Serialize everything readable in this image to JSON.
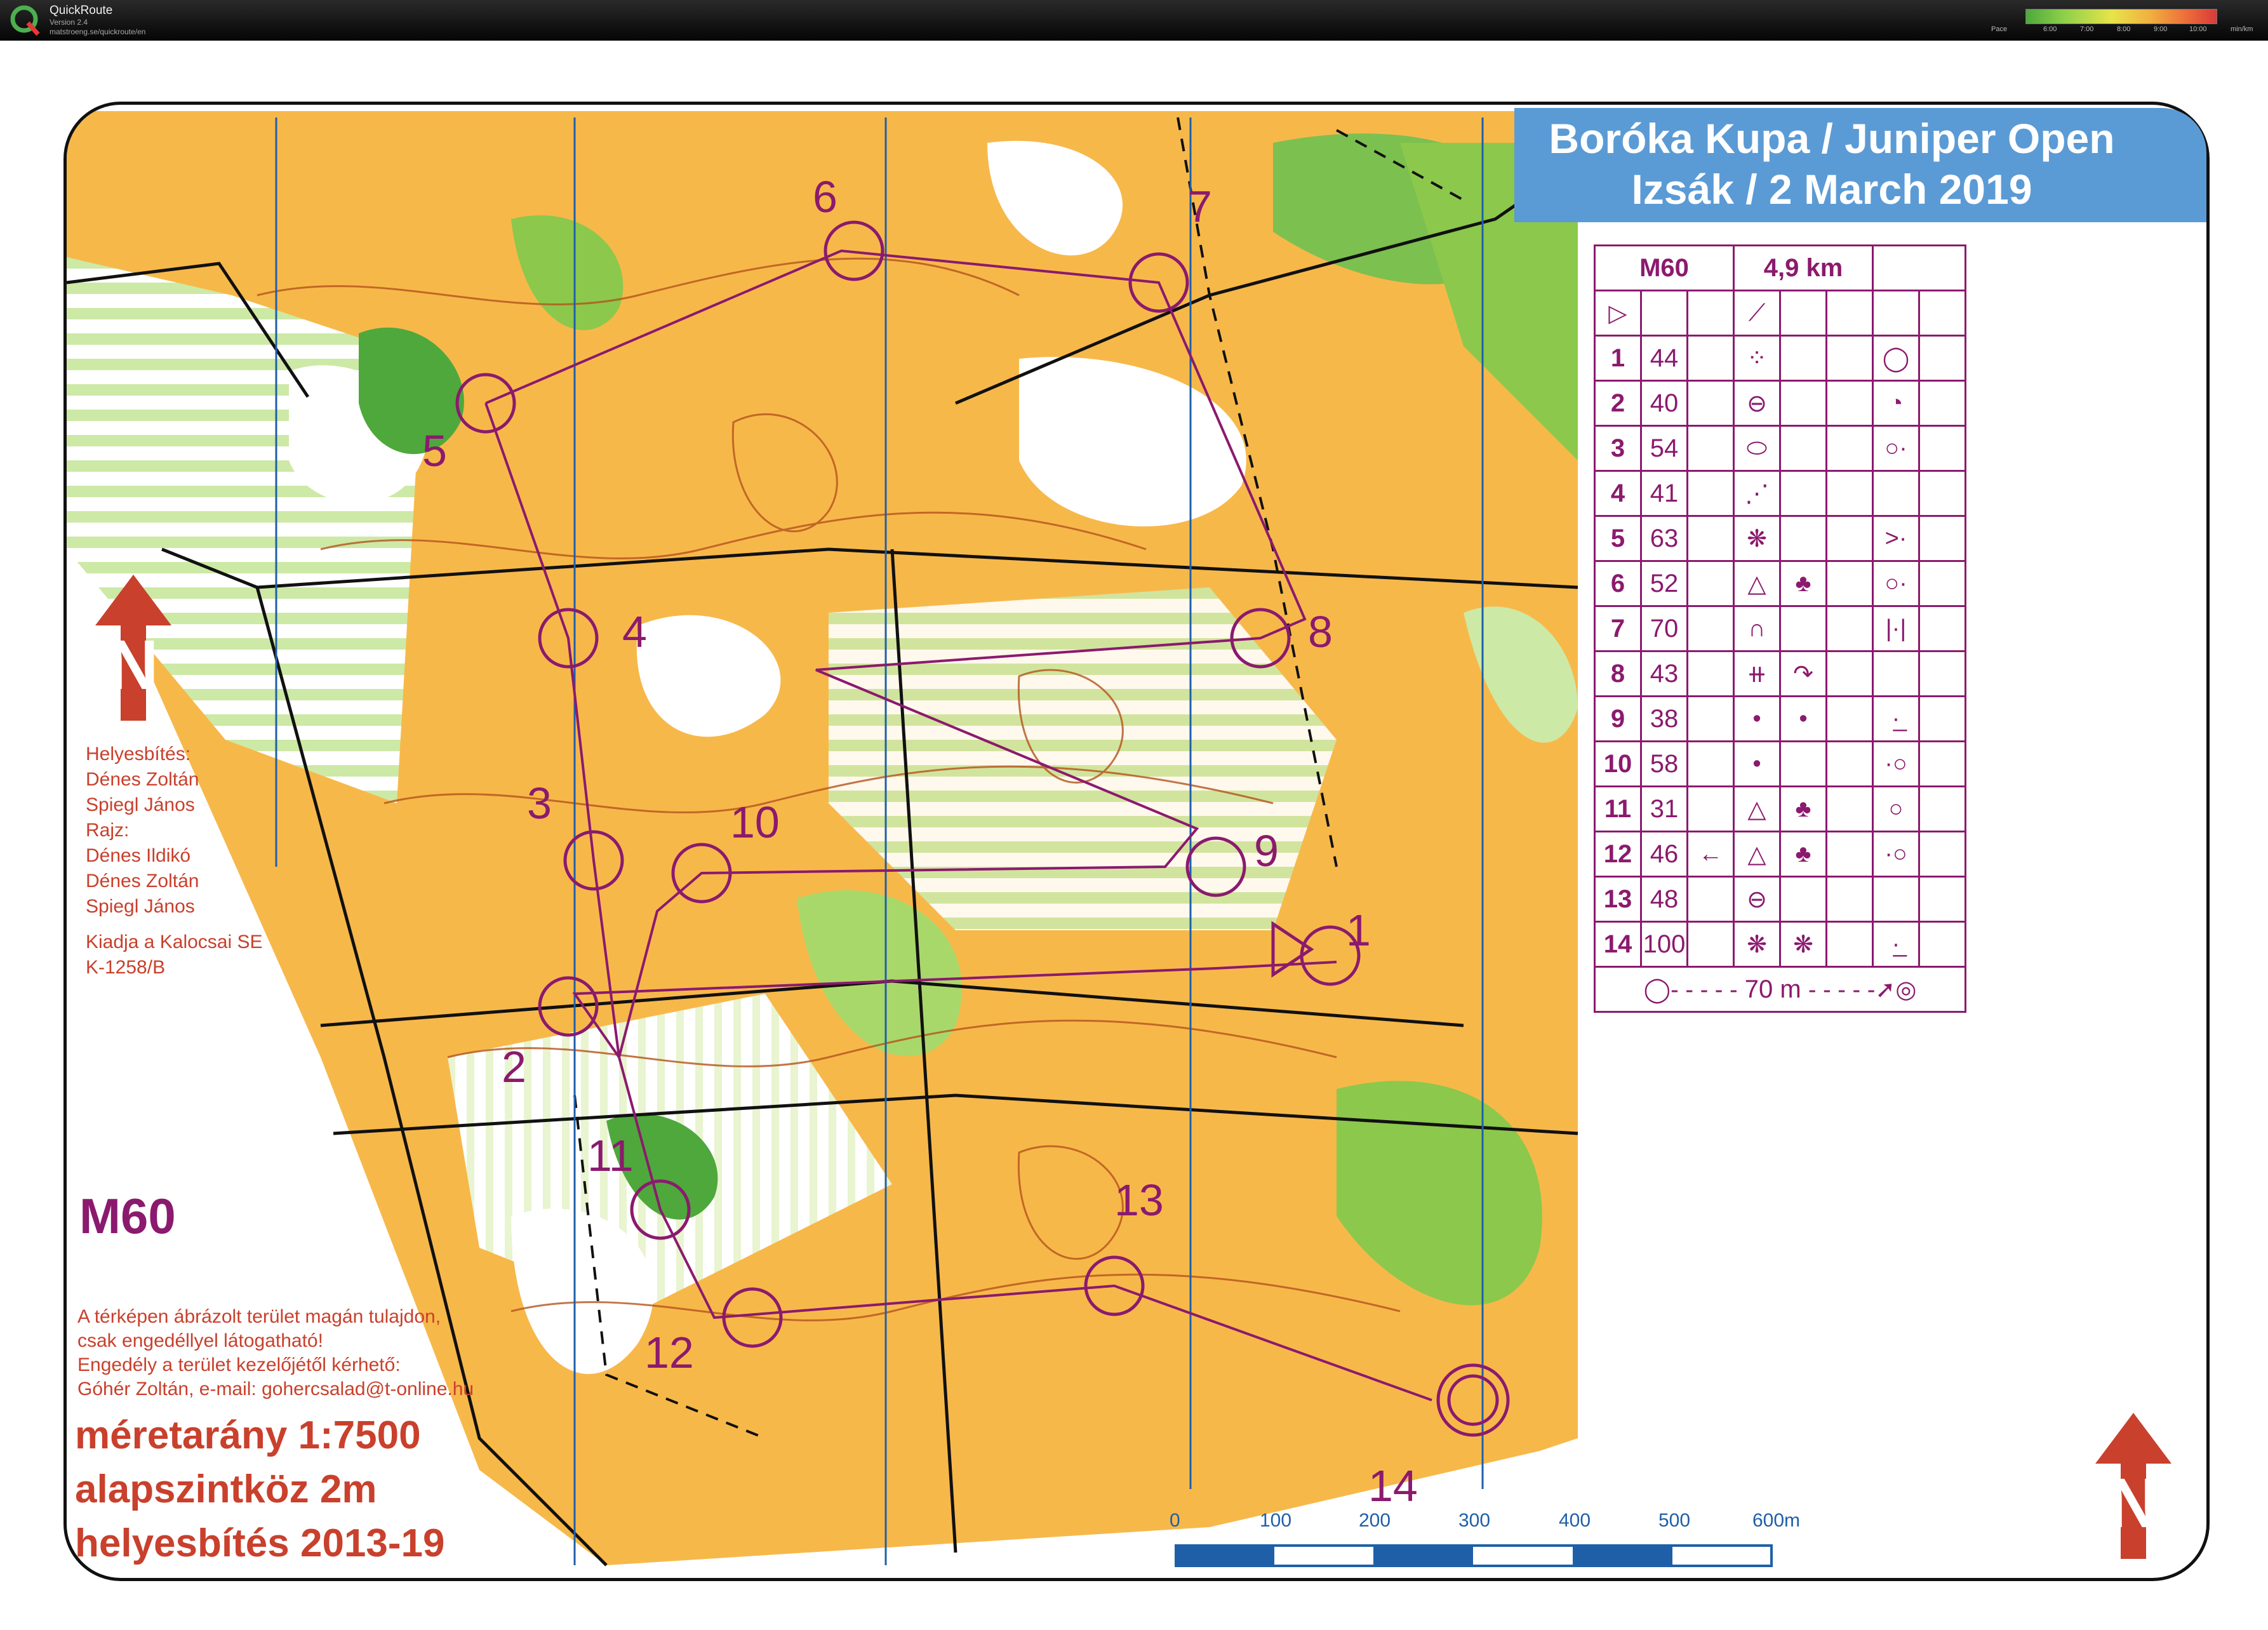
{
  "app": {
    "name": "QuickRoute",
    "version": "Version 2.4",
    "url": "matstroeng.se/quickroute/en",
    "pace_label": "Pace",
    "pace_ticks": [
      "6:00",
      "7:00",
      "8:00",
      "9:00",
      "10:00"
    ],
    "pace_unit": "min/km"
  },
  "map": {
    "title_line1": "Boróka Kupa / Juniper Open",
    "title_line2": "Izsák /  2 March 2019",
    "class_name": "M60",
    "scale": "méretarány 1:7500",
    "contour": "alapszintköz 2m",
    "updated": "helyesbítés 2013-19",
    "credits": [
      "Helyesbítés:",
      "Dénes Zoltán",
      "Spiegl János",
      "Rajz:",
      "Dénes Ildikó",
      "Dénes Zoltán",
      "Spiegl János",
      "",
      "Kiadja a Kalocsai SE",
      "K-1258/B"
    ],
    "notice": [
      "A térképen ábrázolt terület magán tulajdon,",
      "csak engedéllyel látogatható!",
      "Engedély a terület kezelőjétől kérhető:",
      "Góhér Zoltán, e-mail: gohercsalad@t-online.hu"
    ],
    "scale_bar_labels": [
      "0",
      "100",
      "200",
      "300",
      "400",
      "500",
      "600m"
    ],
    "control_labels": [
      "1",
      "2",
      "3",
      "4",
      "5",
      "6",
      "7",
      "8",
      "9",
      "10",
      "11",
      "12",
      "13",
      "14"
    ]
  },
  "colors": {
    "course": "#8b1a6e",
    "forest_open": "#f4a020",
    "green": "#8cc84b",
    "header_blue": "#5b9bd5",
    "red_text": "#c9402c"
  },
  "description": {
    "class": "M60",
    "length": "4,9 km",
    "rows": [
      {
        "num": "1",
        "code": "44"
      },
      {
        "num": "2",
        "code": "40"
      },
      {
        "num": "3",
        "code": "54"
      },
      {
        "num": "4",
        "code": "41"
      },
      {
        "num": "5",
        "code": "63"
      },
      {
        "num": "6",
        "code": "52"
      },
      {
        "num": "7",
        "code": "70"
      },
      {
        "num": "8",
        "code": "43"
      },
      {
        "num": "9",
        "code": "38"
      },
      {
        "num": "10",
        "code": "58"
      },
      {
        "num": "11",
        "code": "31"
      },
      {
        "num": "12",
        "code": "46"
      },
      {
        "num": "13",
        "code": "48"
      },
      {
        "num": "14",
        "code": "100"
      }
    ],
    "finish": "70 m"
  }
}
